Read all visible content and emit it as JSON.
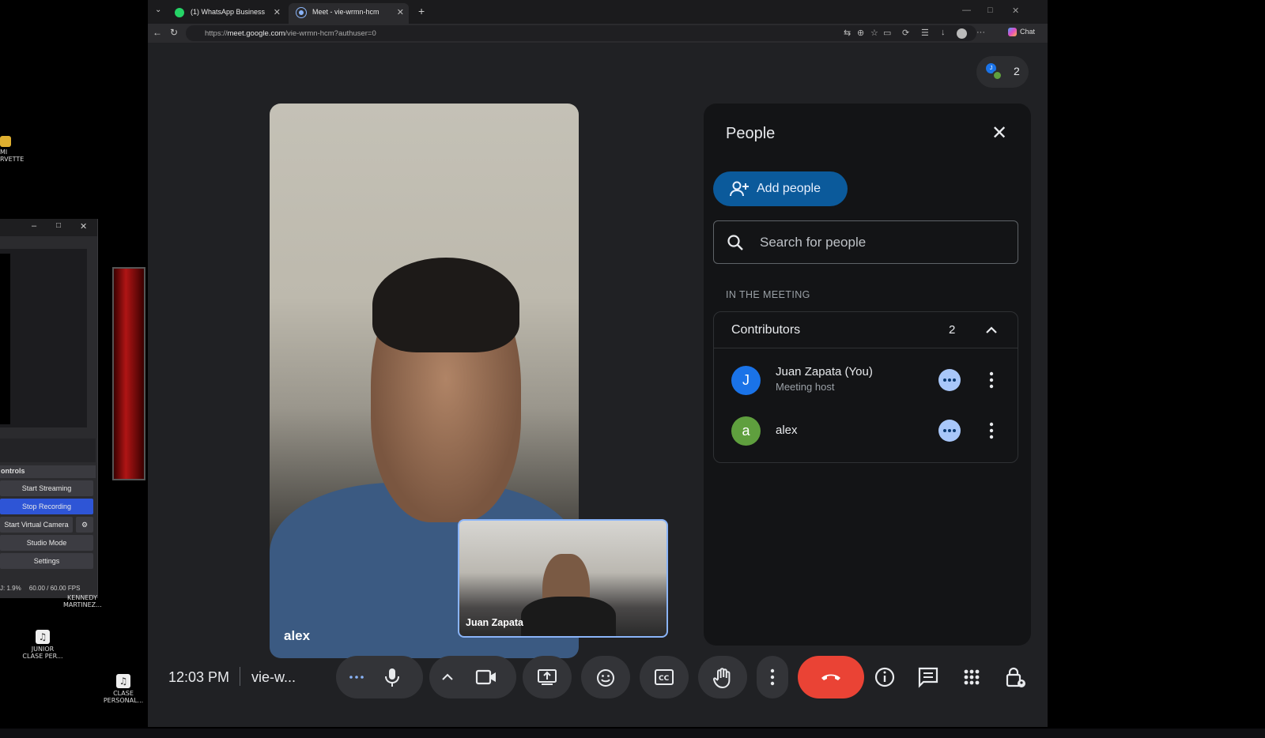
{
  "desktop": {
    "icons": [
      {
        "label": "MI\nRVETTE"
      },
      {
        "label": "KENNEDY\nMARTINEZ..."
      },
      {
        "label": "JUNIOR\nCLASE PER..."
      },
      {
        "label": "CLASE\nPERSONAL..."
      }
    ]
  },
  "obs": {
    "controls_header": "ontrols",
    "buttons": [
      "Start Streaming",
      "Stop Recording",
      "Start Virtual Camera",
      "Studio Mode",
      "Settings"
    ],
    "status_cpu": "J: 1.9%",
    "status_fps": "60.00 / 60.00 FPS"
  },
  "browser": {
    "tabs": [
      {
        "title": "(1) WhatsApp Business"
      },
      {
        "title": "Meet - vie-wrmn-hcm"
      }
    ],
    "url_prefix": "https://",
    "url_host": "meet.google.com",
    "url_path": "/vie-wrmn-hcm?authuser=0",
    "chat_label": "Chat"
  },
  "meet": {
    "participant_count": "2",
    "main_tile_name": "alex",
    "self_tile_name": "Juan Zapata",
    "clock": "12:03 PM",
    "meeting_code": "vie-w...",
    "people_panel": {
      "title": "People",
      "add_people": "Add people",
      "search_placeholder": "Search for people",
      "section_label": "IN THE MEETING",
      "group_label": "Contributors",
      "group_count": "2",
      "participants": [
        {
          "initial": "J",
          "name": "Juan Zapata (You)",
          "role": "Meeting host",
          "color": "#1a73e8"
        },
        {
          "initial": "a",
          "name": "alex",
          "role": "",
          "color": "#5f9f3e"
        }
      ]
    },
    "colors": {
      "accent": "#0b5a9b",
      "end_call": "#ea4335",
      "dots_btn": "#a8c7fa"
    }
  }
}
